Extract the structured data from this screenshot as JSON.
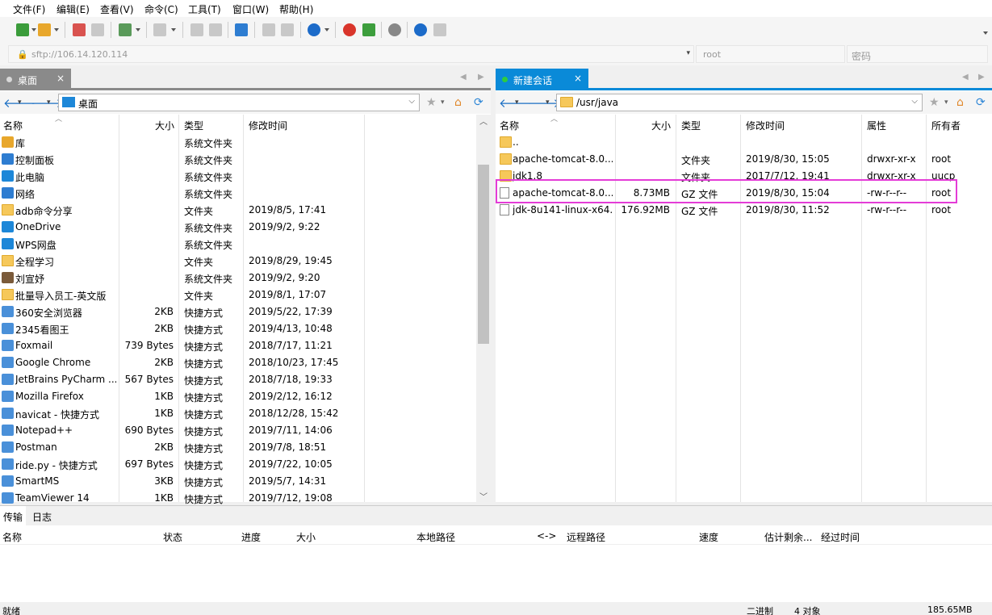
{
  "menu": [
    "文件(F)",
    "编辑(E)",
    "查看(V)",
    "命令(C)",
    "工具(T)",
    "窗口(W)",
    "帮助(H)"
  ],
  "address": {
    "url": "sftp://106.14.120.114",
    "user_placeholder": "root",
    "password_placeholder": "密码"
  },
  "left_pane": {
    "tab": "桌面",
    "path": "桌面",
    "columns": [
      "名称",
      "大小",
      "类型",
      "修改时间"
    ],
    "rows": [
      {
        "name": "库",
        "size": "",
        "type": "系统文件夹",
        "mtime": "",
        "icon": "library-icon"
      },
      {
        "name": "控制面板",
        "size": "",
        "type": "系统文件夹",
        "mtime": "",
        "icon": "control-panel-icon"
      },
      {
        "name": "此电脑",
        "size": "",
        "type": "系统文件夹",
        "mtime": "",
        "icon": "computer-icon"
      },
      {
        "name": "网络",
        "size": "",
        "type": "系统文件夹",
        "mtime": "",
        "icon": "network-icon"
      },
      {
        "name": "adb命令分享",
        "size": "",
        "type": "文件夹",
        "mtime": "2019/8/5, 17:41",
        "icon": "folder-icon"
      },
      {
        "name": "OneDrive",
        "size": "",
        "type": "系统文件夹",
        "mtime": "2019/9/2, 9:22",
        "icon": "cloud-icon"
      },
      {
        "name": "WPS网盘",
        "size": "",
        "type": "系统文件夹",
        "mtime": "",
        "icon": "cloud-icon"
      },
      {
        "name": "全程学习",
        "size": "",
        "type": "文件夹",
        "mtime": "2019/8/29, 19:45",
        "icon": "folder-icon"
      },
      {
        "name": "刘宣妤",
        "size": "",
        "type": "系统文件夹",
        "mtime": "2019/9/2, 9:20",
        "icon": "user-icon"
      },
      {
        "name": "批量导入员工-英文版",
        "size": "",
        "type": "文件夹",
        "mtime": "2019/8/1, 17:07",
        "icon": "folder-icon"
      },
      {
        "name": "360安全浏览器",
        "size": "2KB",
        "type": "快捷方式",
        "mtime": "2019/5/22, 17:39",
        "icon": "shortcut-icon"
      },
      {
        "name": "2345看图王",
        "size": "2KB",
        "type": "快捷方式",
        "mtime": "2019/4/13, 10:48",
        "icon": "shortcut-icon"
      },
      {
        "name": "Foxmail",
        "size": "739 Bytes",
        "type": "快捷方式",
        "mtime": "2018/7/17, 11:21",
        "icon": "shortcut-icon"
      },
      {
        "name": "Google Chrome",
        "size": "2KB",
        "type": "快捷方式",
        "mtime": "2018/10/23, 17:45",
        "icon": "shortcut-icon"
      },
      {
        "name": "JetBrains PyCharm ...",
        "size": "567 Bytes",
        "type": "快捷方式",
        "mtime": "2018/7/18, 19:33",
        "icon": "shortcut-icon"
      },
      {
        "name": "Mozilla Firefox",
        "size": "1KB",
        "type": "快捷方式",
        "mtime": "2019/2/12, 16:12",
        "icon": "shortcut-icon"
      },
      {
        "name": "navicat - 快捷方式",
        "size": "1KB",
        "type": "快捷方式",
        "mtime": "2018/12/28, 15:42",
        "icon": "shortcut-icon"
      },
      {
        "name": "Notepad++",
        "size": "690 Bytes",
        "type": "快捷方式",
        "mtime": "2019/7/11, 14:06",
        "icon": "shortcut-icon"
      },
      {
        "name": "Postman",
        "size": "2KB",
        "type": "快捷方式",
        "mtime": "2019/7/8, 18:51",
        "icon": "shortcut-icon"
      },
      {
        "name": "ride.py - 快捷方式",
        "size": "697 Bytes",
        "type": "快捷方式",
        "mtime": "2019/7/22, 10:05",
        "icon": "shortcut-icon"
      },
      {
        "name": "SmartMS",
        "size": "3KB",
        "type": "快捷方式",
        "mtime": "2019/5/7, 14:31",
        "icon": "shortcut-icon"
      },
      {
        "name": "TeamViewer 14",
        "size": "1KB",
        "type": "快捷方式",
        "mtime": "2019/7/12, 19:08",
        "icon": "shortcut-icon"
      }
    ]
  },
  "right_pane": {
    "tab": "新建会话",
    "path": "/usr/java",
    "columns": [
      "名称",
      "大小",
      "类型",
      "修改时间",
      "属性",
      "所有者"
    ],
    "rows": [
      {
        "name": "..",
        "size": "",
        "type": "",
        "mtime": "",
        "attr": "",
        "owner": "",
        "icon": "folder-icon"
      },
      {
        "name": "apache-tomcat-8.0....",
        "size": "",
        "type": "文件夹",
        "mtime": "2019/8/30, 15:05",
        "attr": "drwxr-xr-x",
        "owner": "root",
        "icon": "folder-icon"
      },
      {
        "name": "jdk1.8",
        "size": "",
        "type": "文件夹",
        "mtime": "2017/7/12, 19:41",
        "attr": "drwxr-xr-x",
        "owner": "uucp",
        "icon": "folder-icon"
      },
      {
        "name": "apache-tomcat-8.0....",
        "size": "8.73MB",
        "type": "GZ 文件",
        "mtime": "2019/8/30, 15:04",
        "attr": "-rw-r--r--",
        "owner": "root",
        "icon": "file-icon"
      },
      {
        "name": "jdk-8u141-linux-x64...",
        "size": "176.92MB",
        "type": "GZ 文件",
        "mtime": "2019/8/30, 11:52",
        "attr": "-rw-r--r--",
        "owner": "root",
        "icon": "file-icon"
      }
    ]
  },
  "bottom": {
    "tabs": [
      "传输",
      "日志"
    ],
    "columns": [
      "名称",
      "状态",
      "进度",
      "大小",
      "本地路径",
      "<->",
      "远程路径",
      "速度",
      "估计剩余...",
      "经过时间"
    ]
  },
  "status": {
    "left": "就绪",
    "mode": "二进制",
    "objects": "4 对象",
    "size": "185.65MB"
  },
  "colors": {
    "active_tab": "#0a8ad8",
    "inactive_tab": "#8a8a8a",
    "highlight": "#e43cd7"
  }
}
